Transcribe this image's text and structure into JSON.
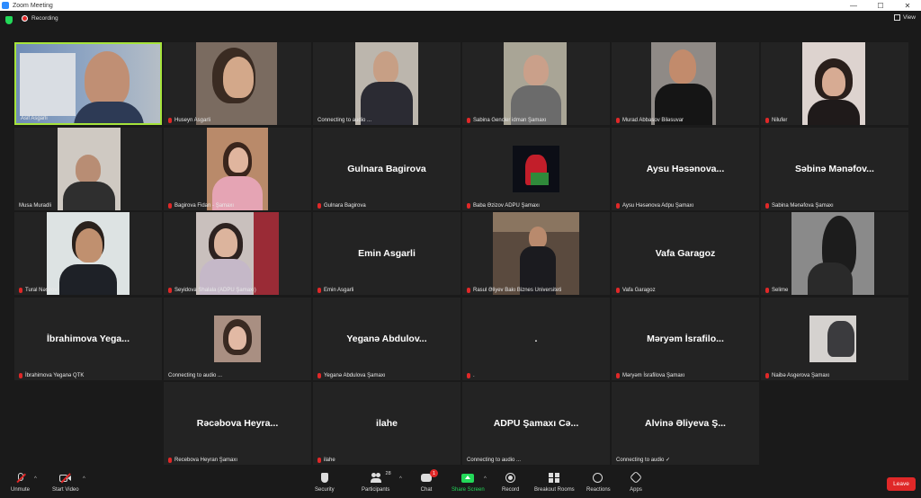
{
  "window": {
    "title": "Zoom Meeting",
    "controls": [
      "—",
      "☐",
      "✕"
    ]
  },
  "topbar": {
    "recording_label": "Recording",
    "view_label": "View"
  },
  "participants": [
    {
      "name": "Asif Asgarli",
      "muted": false,
      "video": true
    },
    {
      "name": "Huseyn Asgarli",
      "muted": true,
      "video": true
    },
    {
      "name": "Connecting to audio ...",
      "muted": false,
      "video": true
    },
    {
      "name": "Sabina Gencler idman Şamaxı",
      "muted": true,
      "video": true
    },
    {
      "name": "Murad Abbasov Biləsuvar",
      "muted": true,
      "video": true
    },
    {
      "name": "Nilufer",
      "muted": true,
      "video": true
    },
    {
      "name": "Musa Muradli",
      "muted": false,
      "video": true
    },
    {
      "name": "Bagirova Fidan - Şamaxı",
      "muted": true,
      "video": true
    },
    {
      "name": "Gulnara Bagirova",
      "display": "Gulnara Bagirova",
      "muted": true,
      "video": false
    },
    {
      "name": "Baba Əzizov ADPU Şamaxı",
      "muted": true,
      "video": true
    },
    {
      "name": "Aysu Həsənova Adpu Şamaxı",
      "display": "Aysu Həsənova...",
      "muted": true,
      "video": false
    },
    {
      "name": "Sabina Mənəfova Şamaxı",
      "display": "Səbinə Mənəfov...",
      "muted": true,
      "video": false
    },
    {
      "name": "Tural Nəsirov",
      "muted": true,
      "video": true
    },
    {
      "name": "Seyidova Shalala (ADPU Şamaxı)",
      "muted": true,
      "video": true
    },
    {
      "name": "Emin Asgarli",
      "display": "Emin Asgarli",
      "muted": true,
      "video": false
    },
    {
      "name": "Rasul Əliyev Bakı Biznes Universiteti",
      "muted": true,
      "video": true
    },
    {
      "name": "Vafa Garagoz",
      "display": "Vafa Garagoz",
      "muted": true,
      "video": false
    },
    {
      "name": "Selime",
      "muted": true,
      "video": true
    },
    {
      "name": "İbrahimova Yeganə QTK",
      "display": "İbrahimova Yega...",
      "muted": true,
      "video": false
    },
    {
      "name": "Connecting to audio ...",
      "muted": false,
      "video": true
    },
    {
      "name": "Yeganə Abdulova Şamaxı",
      "display": "Yeganə Abdulov...",
      "muted": true,
      "video": false
    },
    {
      "name": ".",
      "display": ".",
      "muted": true,
      "video": false
    },
    {
      "name": "Məryəm İsrafilova Şamaxı",
      "display": "Məryəm İsrafilo...",
      "muted": true,
      "video": false
    },
    {
      "name": "Naibə Asgerova Şamaxı",
      "muted": true,
      "video": true
    },
    {
      "name": "Recebova Heyran Şamaxı",
      "display": "Rəcəbova Heyra...",
      "muted": true,
      "video": false
    },
    {
      "name": "ilahe",
      "display": "ilahe",
      "muted": true,
      "video": false
    },
    {
      "name": "Connecting to audio ...",
      "display": "ADPU Şamaxı Cə...",
      "muted": false,
      "video": false
    },
    {
      "name": "Connecting to audio ✓",
      "display": "Alvinə Əliyeva Ş...",
      "muted": false,
      "video": false
    }
  ],
  "toolbar": {
    "unmute": "Unmute",
    "start_video": "Start Video",
    "security": "Security",
    "participants": "Participants",
    "participants_count": "28",
    "chat": "Chat",
    "chat_badge": "1",
    "share_screen": "Share Screen",
    "record": "Record",
    "breakout_rooms": "Breakout Rooms",
    "reactions": "Reactions",
    "apps": "Apps",
    "leave": "Leave"
  },
  "colors": {
    "active_speaker_border": "#a6e33b",
    "leave_button": "#e02828",
    "share_screen": "#23d959"
  }
}
